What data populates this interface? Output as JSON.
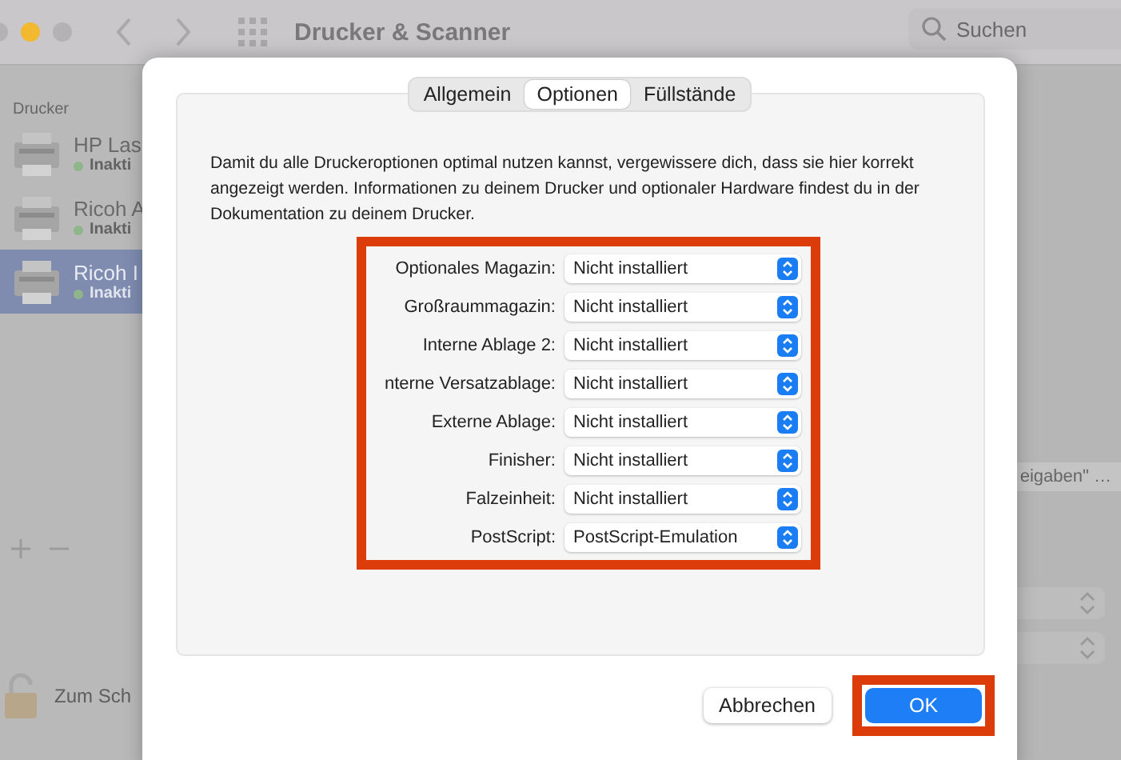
{
  "background_window": {
    "title": "Drucker & Scanner",
    "search": {
      "placeholder": "Suchen"
    },
    "sidebar": {
      "header": "Drucker",
      "items": [
        {
          "name": "HP Las",
          "status": "Inakti",
          "selected": false
        },
        {
          "name": "Ricoh A",
          "status": "Inakti",
          "selected": false
        },
        {
          "name": "Ricoh I",
          "status": "Inakti",
          "selected": true
        }
      ]
    },
    "share_button": "eigaben\" …",
    "lock_label": "Zum Sch"
  },
  "dialog": {
    "tabs": [
      {
        "label": "Allgemein",
        "selected": false
      },
      {
        "label": "Optionen",
        "selected": true
      },
      {
        "label": "Füllstände",
        "selected": false
      }
    ],
    "description": "Damit du alle Druckeroptionen optimal nutzen kannst, vergewissere dich, dass sie hier korrekt angezeigt werden. Informationen zu deinem Drucker und optionaler Hardware findest du in der Dokumentation zu deinem Drucker.",
    "options_highlighted": true,
    "options": [
      {
        "label": "Optionales Magazin:",
        "value": "Nicht installiert"
      },
      {
        "label": "Großraummagazin:",
        "value": "Nicht installiert"
      },
      {
        "label": "Interne Ablage 2:",
        "value": "Nicht installiert"
      },
      {
        "label": "nterne Versatzablage:",
        "value": "Nicht installiert"
      },
      {
        "label": "Externe Ablage:",
        "value": "Nicht installiert"
      },
      {
        "label": "Finisher:",
        "value": "Nicht installiert"
      },
      {
        "label": "Falzeinheit:",
        "value": "Nicht installiert"
      },
      {
        "label": "PostScript:",
        "value": "PostScript-Emulation"
      }
    ],
    "buttons": [
      {
        "label": "Abbrechen",
        "kind": "cancel",
        "highlighted": false
      },
      {
        "label": "OK",
        "kind": "default",
        "highlighted": true
      }
    ]
  }
}
